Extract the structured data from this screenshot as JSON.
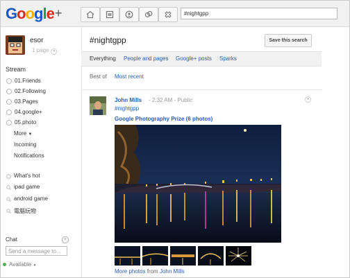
{
  "app": {
    "logo_text": "Google",
    "logo_plus": "+"
  },
  "search": {
    "value": "#nightgpp"
  },
  "nav_icons": [
    "home-icon",
    "photos-icon",
    "profile-icon",
    "circles-icon",
    "games-icon"
  ],
  "sidebar": {
    "user_name": "esor",
    "page_selector": "1 page",
    "stream_heading": "Stream",
    "stream_items": [
      {
        "label": "01.Friends"
      },
      {
        "label": "02.Following"
      },
      {
        "label": "03.Pages"
      },
      {
        "label": "04.google+"
      },
      {
        "label": "05.photo"
      }
    ],
    "more_label": "More",
    "incoming_label": "Incoming",
    "notifications_label": "Notifications",
    "whats_hot_label": "What's hot",
    "saved_searches": [
      {
        "label": "ipad game"
      },
      {
        "label": "android game"
      },
      {
        "label": "電腦玩物"
      }
    ],
    "chat_heading": "Chat",
    "chat_placeholder": "Send a message to...",
    "availability": "Available"
  },
  "main": {
    "search_title": "#nightgpp",
    "save_button": "Save this search",
    "tabs": [
      {
        "label": "Everything"
      },
      {
        "label": "People and pages"
      },
      {
        "label": "Google+ posts"
      },
      {
        "label": "Sparks"
      }
    ],
    "filter_label": "Best of",
    "filter_active": "Most recent"
  },
  "post": {
    "author": "John Mills",
    "time": "2:32 AM",
    "visibility": "Public",
    "hashtag": "#nightgpp",
    "album_title": "Google Photography Prize (6 photos)",
    "more_photos": "More photos",
    "from_label": "from",
    "from_author": "John Mills"
  },
  "colors": {
    "link": "#2a5db0",
    "topbar": "#f1f1f1",
    "tabbar": "#f1f1f1"
  }
}
